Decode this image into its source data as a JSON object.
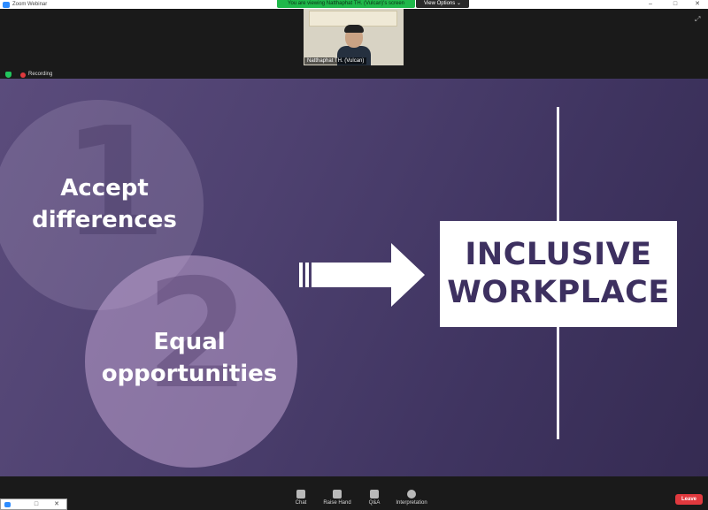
{
  "window": {
    "title": "Zoom Webinar",
    "minimize": "–",
    "maximize": "□",
    "close": "✕"
  },
  "share": {
    "banner": "You are viewing Natthaphat TH. (Vulcan)'s screen",
    "view_options": "View Options ⌄"
  },
  "video": {
    "participant_name": "Natthaphat TH. (Vulcan)",
    "expand_icon": "⤢"
  },
  "status": {
    "recording_label": "Recording"
  },
  "slide": {
    "number_1": "1",
    "number_2": "2",
    "item_1": "Accept differences",
    "item_2": "Equal opportunities",
    "box_line_1": "INCLUSIVE",
    "box_line_2": "WORKPLACE"
  },
  "toolbar": {
    "items": [
      {
        "label": "Chat",
        "icon": "chat-icon"
      },
      {
        "label": "Raise Hand",
        "icon": "hand-icon"
      },
      {
        "label": "Q&A",
        "icon": "qa-icon"
      },
      {
        "label": "Interpretation",
        "icon": "globe-icon"
      }
    ],
    "leave_label": "Leave"
  },
  "taskbar_thumb": {
    "btn1": "□",
    "btn2": "✕"
  },
  "colors": {
    "accent_green": "#1fb84a",
    "leave_red": "#e0393e",
    "slide_purple": "#4e4170",
    "box_text": "#3d3060"
  }
}
